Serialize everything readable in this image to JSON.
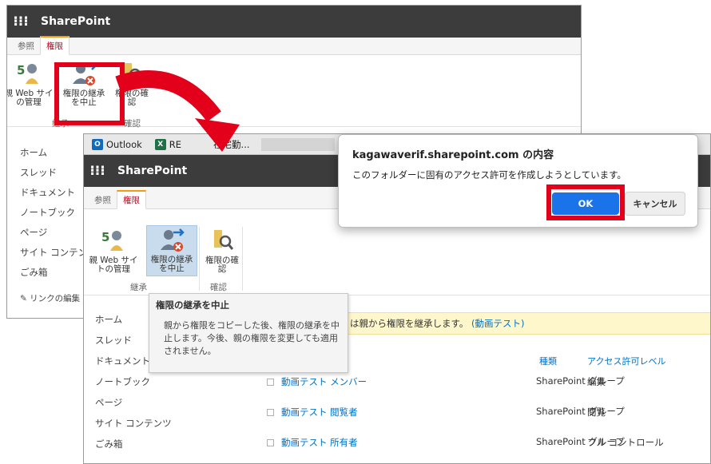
{
  "app": {
    "brand": "SharePoint",
    "waffle_glyph": "⁝⁝⁝"
  },
  "ribbon": {
    "tabs": [
      "参照",
      "権限"
    ],
    "buttons": {
      "parent_web": "親 Web サイトの管理",
      "parent_web_short": "親 Web サイ の管理",
      "stop_inherit": "権限の継承を中止",
      "check": "権限の確認"
    },
    "groups": {
      "inherit": "継承",
      "check": "確認"
    }
  },
  "nav": {
    "items": [
      "ホーム",
      "スレッド",
      "ドキュメント",
      "ノートブック",
      "ページ",
      "サイト コンテンツ",
      "ごみ箱"
    ],
    "edit_links": "リンクの編集"
  },
  "taskbar": {
    "outlook": "Outlook",
    "excel_label": "RE",
    "excel_rest": "在宅勤..."
  },
  "tooltip": {
    "title": "権限の継承を中止",
    "body": "親から権限をコピーした後、権限の継承を中止します。今後、親の権限を変更しても適用されません。"
  },
  "banner": {
    "text": "は親から権限を継承します。",
    "link": "(動画テスト)"
  },
  "grid": {
    "headers": {
      "type": "種類",
      "level": "アクセス許可レベル"
    },
    "rows": [
      {
        "name": "動画テスト メンバー",
        "type": "SharePoint グループ",
        "level": "編集"
      },
      {
        "name": "動画テスト 閲覧者",
        "type": "SharePoint グループ",
        "level": "閲覧"
      },
      {
        "name": "動画テスト 所有者",
        "type": "SharePoint グループ",
        "level": "フル コントロール"
      }
    ]
  },
  "dialog": {
    "title": "kagawaverif.sharepoint.com の内容",
    "message": "このフォルダーに固有のアクセス許可を作成しようとしています。",
    "ok": "OK",
    "cancel": "キャンセル"
  },
  "colors": {
    "highlight_box": "#e2001a",
    "ok_button": "#1a73e8",
    "suitebar": "#3c3c3c",
    "link": "#0072c6"
  }
}
